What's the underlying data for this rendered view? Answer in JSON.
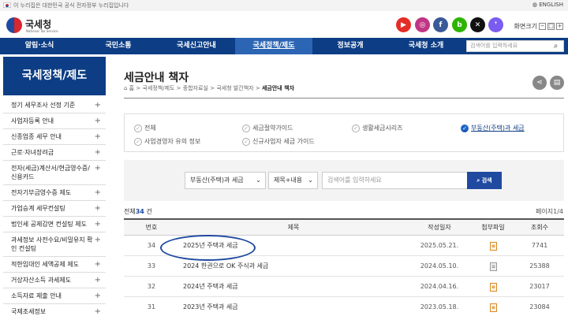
{
  "top_strip": {
    "notice": "이 누리집은 대한민국 공식 전자정부 누리집입니다",
    "language": "ENGLISH"
  },
  "header": {
    "logo_name": "국세청",
    "logo_sub": "National Tax Service",
    "social": [
      {
        "icon": "youtube-icon",
        "glyph": "▶",
        "color": "#e52d27"
      },
      {
        "icon": "instagram-icon",
        "glyph": "◎",
        "color": "#c13584"
      },
      {
        "icon": "facebook-icon",
        "glyph": "f",
        "color": "#3b5998"
      },
      {
        "icon": "blog-icon",
        "glyph": "b",
        "color": "#2db400"
      },
      {
        "icon": "x-icon",
        "glyph": "✕",
        "color": "#111111"
      },
      {
        "icon": "story-icon",
        "glyph": "❜",
        "color": "#7b5cf0"
      }
    ],
    "zoom_label": "화면크기",
    "zoom_minus": "−",
    "zoom_reset": "□",
    "zoom_plus": "+"
  },
  "nav": {
    "items": [
      "알림·소식",
      "국민소통",
      "국세신고안내",
      "국세정책/제도",
      "정보공개",
      "국세청 소개"
    ],
    "active_index": 3,
    "search_placeholder": "검색어를 입력하세요"
  },
  "sidebar": {
    "title": "국세정책/제도",
    "items": [
      "정기 세무조사 선정 기준",
      "사업자등록 안내",
      "신종업종 세무 안내",
      "근로·자녀장려금",
      "전자(세금)계산서/현금영수증/신용카드",
      "전자기부금영수증 제도",
      "가업승계 세무컨설팅",
      "법인세 공제감면 컨설팅 제도",
      "과세정보 사전수요/비밀유지 확인 컨설팅",
      "적한임대인 세액공제 제도",
      "거상자산소득 과세제도",
      "소득자료 제출 안내",
      "국제조세정보"
    ]
  },
  "main": {
    "title": "세금안내 책자",
    "breadcrumb": [
      "홈",
      "국세정책/제도",
      "종합자료실",
      "국세청 발간책자",
      "세금안내 책자"
    ],
    "categories": [
      "전체",
      "세금절약가이드",
      "생활세금시리즈",
      "부동산(주택)과 세금",
      "사업경영자 유의 정보",
      "신규사업자 세금 가이드"
    ],
    "active_category": 3,
    "search": {
      "category_select": "부동산(주택)과 세금",
      "field_select": "제목+내용",
      "placeholder": "검색어를 입력하세요",
      "button": "검색"
    },
    "total_prefix": "전체",
    "total_count": "34",
    "total_suffix": "건",
    "page_info": "페이지1/4",
    "table": {
      "headers": [
        "번호",
        "제목",
        "작성일자",
        "첨부파일",
        "조회수"
      ],
      "rows": [
        {
          "no": "34",
          "title": "2025년 주택과 세금",
          "date": "2025.05.21.",
          "file": "e",
          "views": "7741"
        },
        {
          "no": "33",
          "title": "2024 한권으로 OK 주식과 세금",
          "date": "2024.05.10.",
          "file": "doc",
          "views": "25388"
        },
        {
          "no": "32",
          "title": "2024년 주택과 세금",
          "date": "2024.04.16.",
          "file": "e",
          "views": "23017"
        },
        {
          "no": "31",
          "title": "2023년 주택과 세금",
          "date": "2023.05.18.",
          "file": "e",
          "views": "23084"
        }
      ]
    }
  }
}
